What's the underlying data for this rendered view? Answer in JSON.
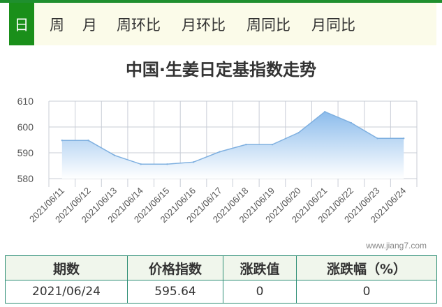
{
  "tabs": [
    {
      "label": "日",
      "active": true
    },
    {
      "label": "周",
      "active": false
    },
    {
      "label": "月",
      "active": false
    },
    {
      "label": "周环比",
      "active": false
    },
    {
      "label": "月环比",
      "active": false
    },
    {
      "label": "周同比",
      "active": false
    },
    {
      "label": "月同比",
      "active": false
    }
  ],
  "chart_data": {
    "type": "area",
    "title": "中国·生姜日定基指数走势",
    "xlabel": "",
    "ylabel": "",
    "ylim": [
      580,
      610
    ],
    "yticks": [
      580,
      590,
      600,
      610
    ],
    "grid": true,
    "legend": "none",
    "categories": [
      "2021/06/11",
      "2021/06/12",
      "2021/06/13",
      "2021/06/14",
      "2021/06/15",
      "2021/06/16",
      "2021/06/17",
      "2021/06/18",
      "2021/06/19",
      "2021/06/20",
      "2021/06/21",
      "2021/06/22",
      "2021/06/23",
      "2021/06/24"
    ],
    "series": [
      {
        "values": [
          594.8,
          594.8,
          589.0,
          585.6,
          585.6,
          586.4,
          590.4,
          593.2,
          593.2,
          597.8,
          605.9,
          601.6,
          595.6,
          595.6
        ]
      }
    ],
    "colors": {
      "line": "#7fb0e0",
      "fill_top": "#8cbcec",
      "fill_bottom": "#ffffff",
      "grid": "#c8cdd6"
    }
  },
  "watermark": "www.jiang7.com",
  "summary": {
    "headers": [
      "期数",
      "价格指数",
      "涨跌值",
      "涨跌幅（%）"
    ],
    "row": [
      "2021/06/24",
      "595.64",
      "0",
      "0"
    ]
  }
}
